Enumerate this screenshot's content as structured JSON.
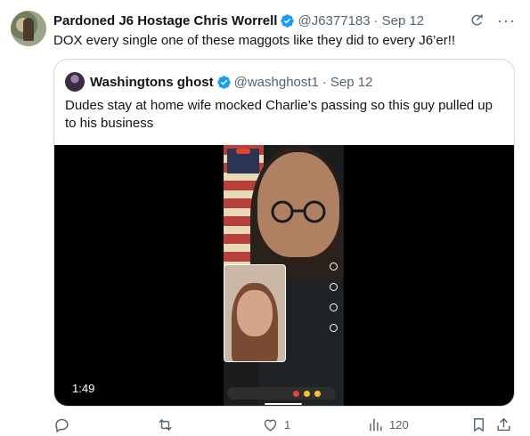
{
  "tweet": {
    "author_name": "Pardoned J6 Hostage Chris Worrell",
    "handle": "@J6377183",
    "separator": "·",
    "date": "Sep 12",
    "more": "···",
    "text": "DOX every single one of these maggots like they did to every J6’er!!"
  },
  "quote": {
    "author_name": "Washingtons ghost",
    "handle": "@washghost1",
    "separator": "·",
    "date": "Sep 12",
    "text": "Dudes stay at home wife mocked Charlie’s passing so this guy pulled up to his business",
    "video": {
      "duration": "1:49"
    }
  },
  "actions": {
    "replies": "",
    "reposts": "",
    "likes": "1",
    "views": "120"
  },
  "colors": {
    "verified": "#1d9bf0",
    "secondary_text": "#536471",
    "border": "#cfd9de"
  },
  "icons": [
    "verified-badge-icon",
    "grok-icon",
    "more-icon",
    "reply-icon",
    "repost-icon",
    "like-icon",
    "views-icon",
    "bookmark-icon",
    "share-icon"
  ]
}
